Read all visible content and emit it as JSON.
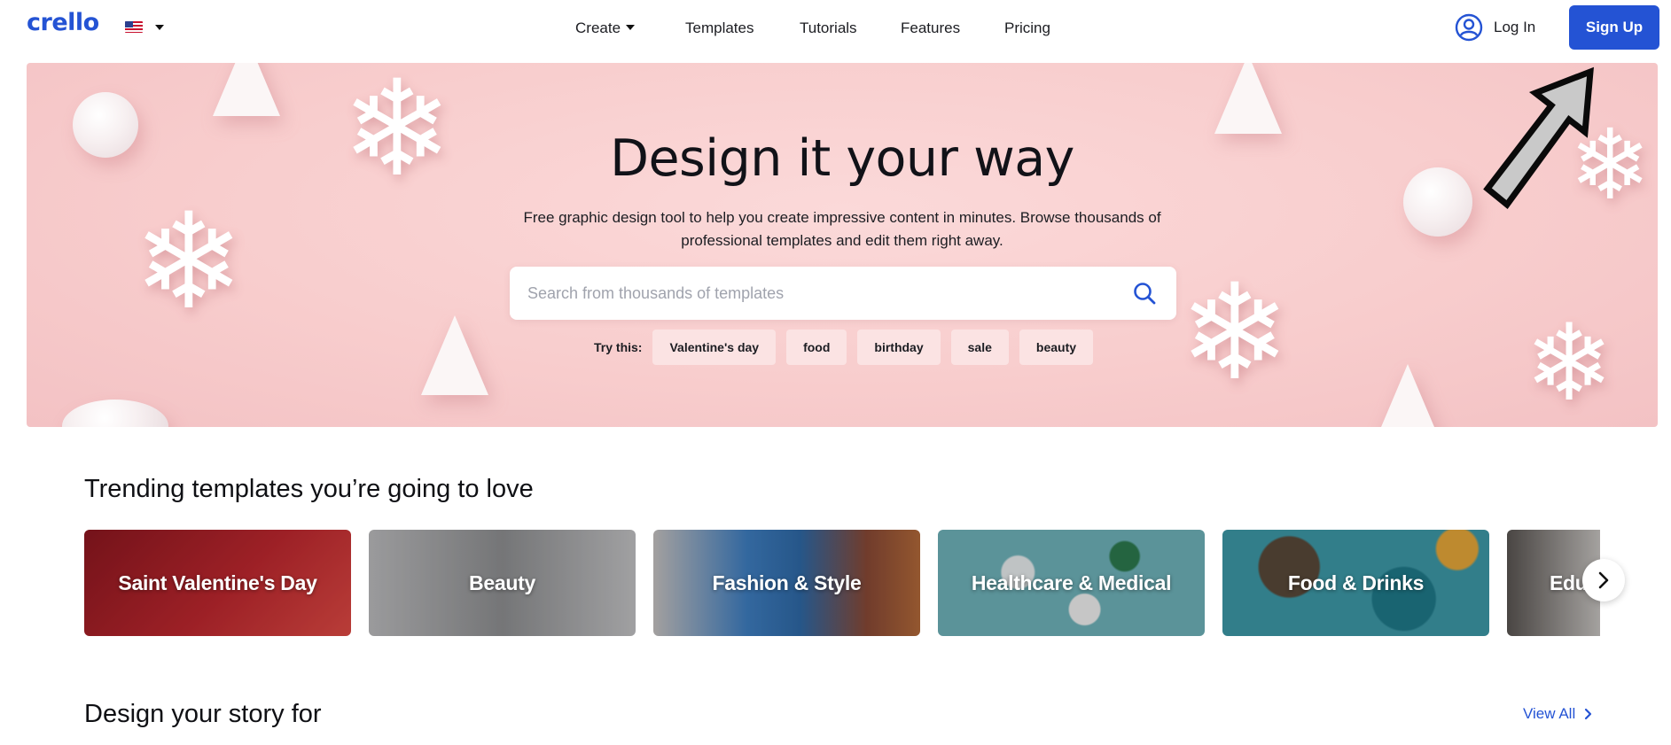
{
  "header": {
    "logo": "crello",
    "nav": [
      {
        "label": "Create",
        "has_dropdown": true
      },
      {
        "label": "Templates"
      },
      {
        "label": "Tutorials"
      },
      {
        "label": "Features"
      },
      {
        "label": "Pricing"
      }
    ],
    "login_label": "Log In",
    "signup_label": "Sign Up"
  },
  "hero": {
    "title": "Design it your way",
    "subtitle": "Free graphic design tool to help you create impressive content in minutes. Browse thousands of professional templates and edit them right away.",
    "search_placeholder": "Search from thousands of templates",
    "try_label": "Try this:",
    "suggestions": [
      "Valentine's day",
      "food",
      "birthday",
      "sale",
      "beauty"
    ]
  },
  "trending": {
    "title": "Trending templates you’re going to love",
    "cards": [
      {
        "label": "Saint Valentine's Day",
        "color": "#b8242e"
      },
      {
        "label": "Beauty",
        "color": "#a9a9ab"
      },
      {
        "label": "Fashion & Style",
        "color": "#5b86b5"
      },
      {
        "label": "Healthcare & Medical",
        "color": "#6fb0b5"
      },
      {
        "label": "Food & Drinks",
        "color": "#3f99a8"
      },
      {
        "label": "Education",
        "color": "#c7c4c1"
      }
    ]
  },
  "story": {
    "title": "Design your story for",
    "view_all_label": "View All"
  },
  "colors": {
    "brand": "#2453d4",
    "hero_bg": "#f8cdcd",
    "chip_bg": "#fbe3e3"
  }
}
